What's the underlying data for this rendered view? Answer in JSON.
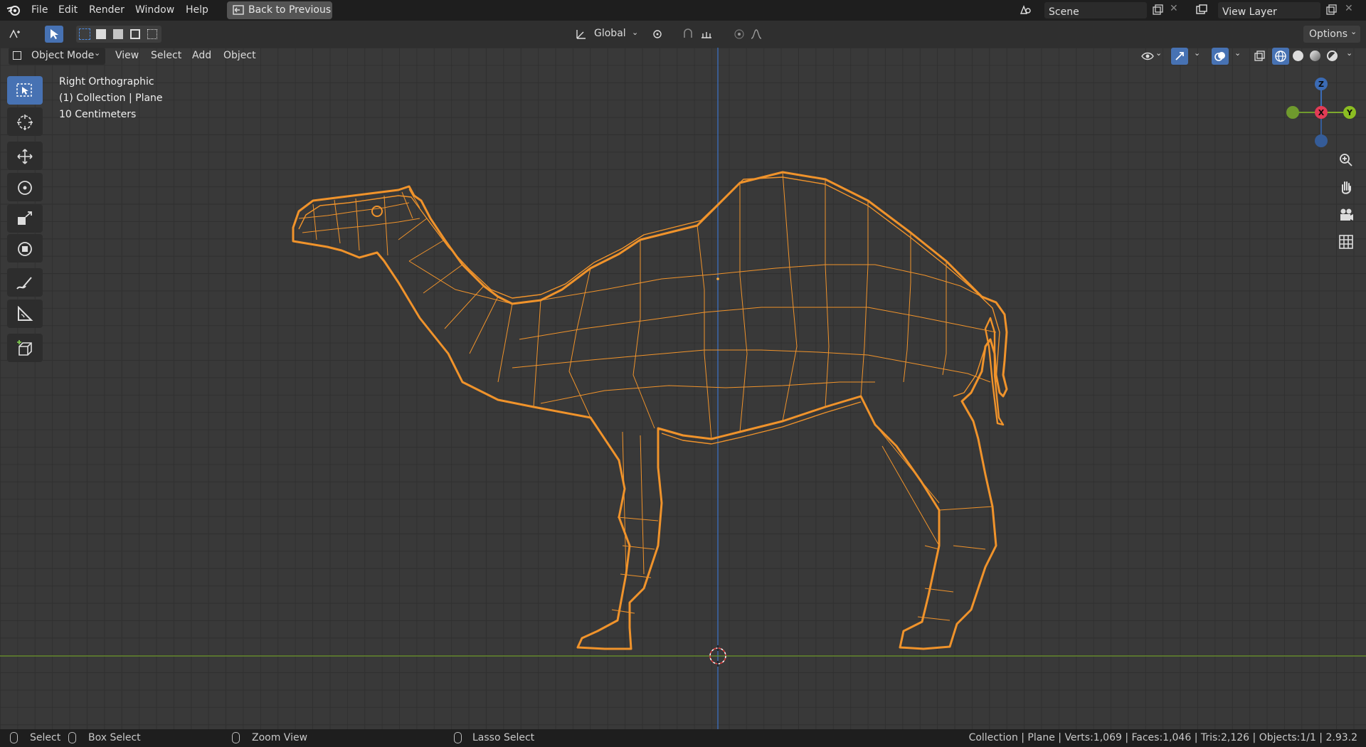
{
  "topbar": {
    "menus": [
      "File",
      "Edit",
      "Render",
      "Window",
      "Help"
    ],
    "back_button": "Back to Previous",
    "scene_name": "Scene",
    "view_layer_name": "View Layer"
  },
  "header": {
    "transform_orientation": "Global",
    "options_label": "Options",
    "mode_label": "Object Mode",
    "view_menus": [
      "View",
      "Select",
      "Add",
      "Object"
    ]
  },
  "viewport": {
    "view_name": "Right Orthographic",
    "collection_info": "(1) Collection | Plane",
    "scale_info": "10 Centimeters",
    "gizmo_labels": {
      "z": "Z",
      "x": "X",
      "y": "Y"
    },
    "object_outline_color": "#f0932b",
    "grid_color": "#393939",
    "x_axis_color": "#6f9a2d",
    "z_axis_color": "#3b6bb5"
  },
  "statusbar": {
    "select": "Select",
    "box_select": "Box Select",
    "zoom_view": "Zoom View",
    "lasso_select": "Lasso Select",
    "stats": "Collection | Plane | Verts:1,069 | Faces:1,046 | Tris:2,126 | Objects:1/1 | 2.93.2"
  },
  "icons": [
    "blender-logo-icon",
    "back-icon",
    "scene-icon",
    "view-layer-icon",
    "select-box-icon",
    "cursor-icon",
    "move-icon",
    "rotate-icon",
    "scale-icon",
    "transform-icon",
    "annotate-icon",
    "measure-icon",
    "add-cube-icon",
    "zoom-icon",
    "hand-icon",
    "camera-icon",
    "grid-icon"
  ]
}
